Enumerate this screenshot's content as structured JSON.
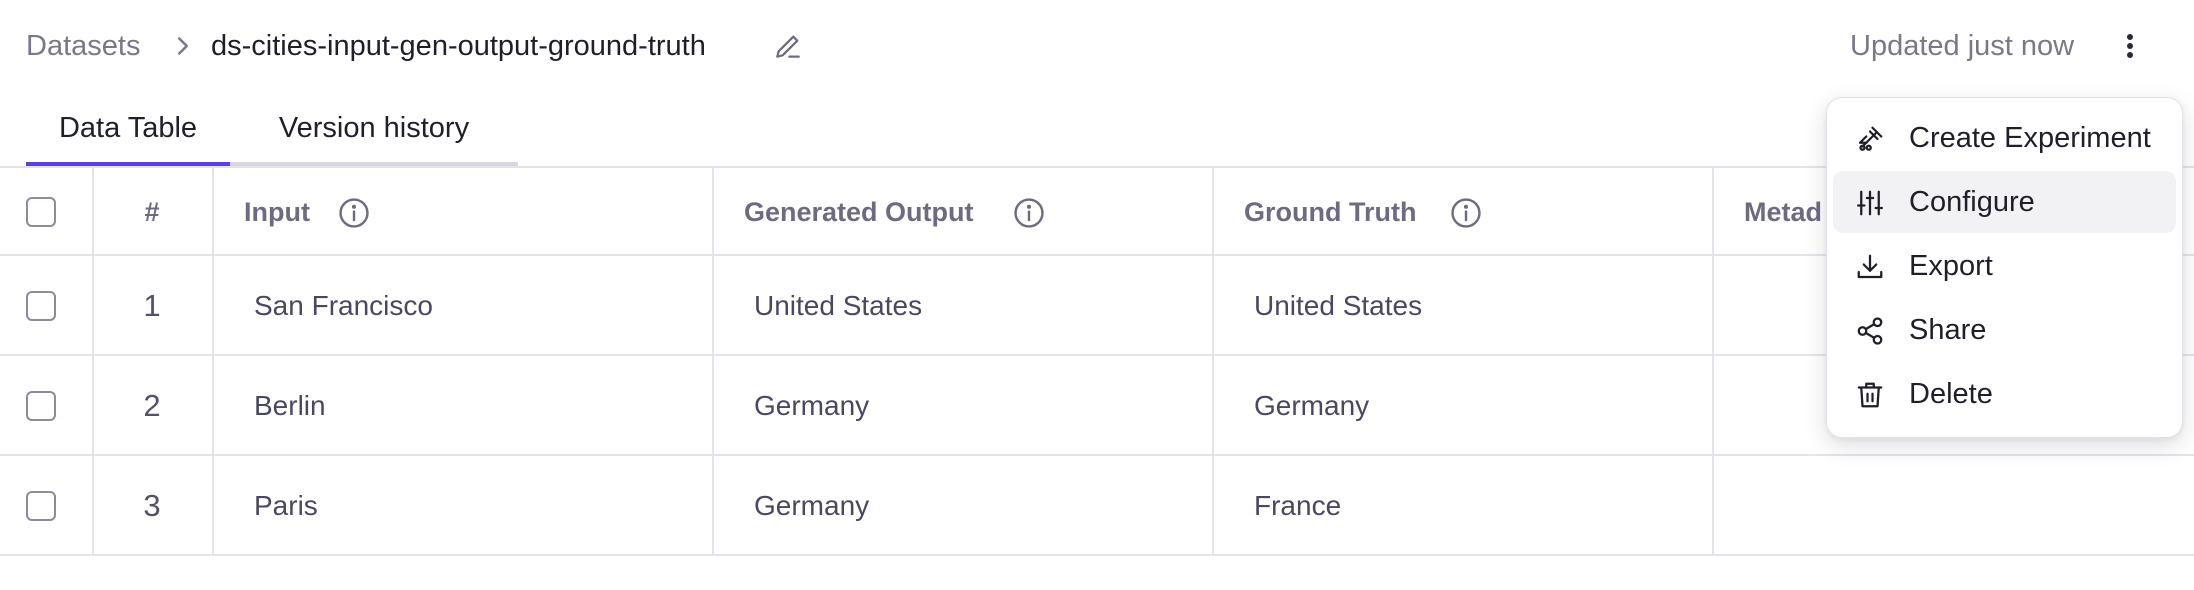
{
  "breadcrumb": {
    "root": "Datasets",
    "name": "ds-cities-input-gen-output-ground-truth"
  },
  "status": {
    "updated": "Updated just now"
  },
  "tabs": [
    {
      "label": "Data Table",
      "active": true
    },
    {
      "label": "Version history",
      "active": false
    }
  ],
  "table": {
    "columns": {
      "index": "#",
      "input": "Input",
      "generated": "Generated Output",
      "ground_truth": "Ground Truth",
      "metadata": "Metad"
    },
    "rows": [
      {
        "index": "1",
        "input": "San Francisco",
        "generated": "United States",
        "ground_truth": "United States"
      },
      {
        "index": "2",
        "input": "Berlin",
        "generated": "Germany",
        "ground_truth": "Germany"
      },
      {
        "index": "3",
        "input": "Paris",
        "generated": "Germany",
        "ground_truth": "France"
      }
    ]
  },
  "menu": {
    "items": [
      {
        "label": "Create Experiment",
        "icon": "flask-icon"
      },
      {
        "label": "Configure",
        "icon": "sliders-icon",
        "highlighted": true
      },
      {
        "label": "Export",
        "icon": "download-icon"
      },
      {
        "label": "Share",
        "icon": "share-icon"
      },
      {
        "label": "Delete",
        "icon": "trash-icon"
      }
    ]
  },
  "colors": {
    "accent": "#5b40e6",
    "muted_text": "#7a7886",
    "border": "#e4e3ea",
    "menu_highlight": "#f2f2f5"
  }
}
